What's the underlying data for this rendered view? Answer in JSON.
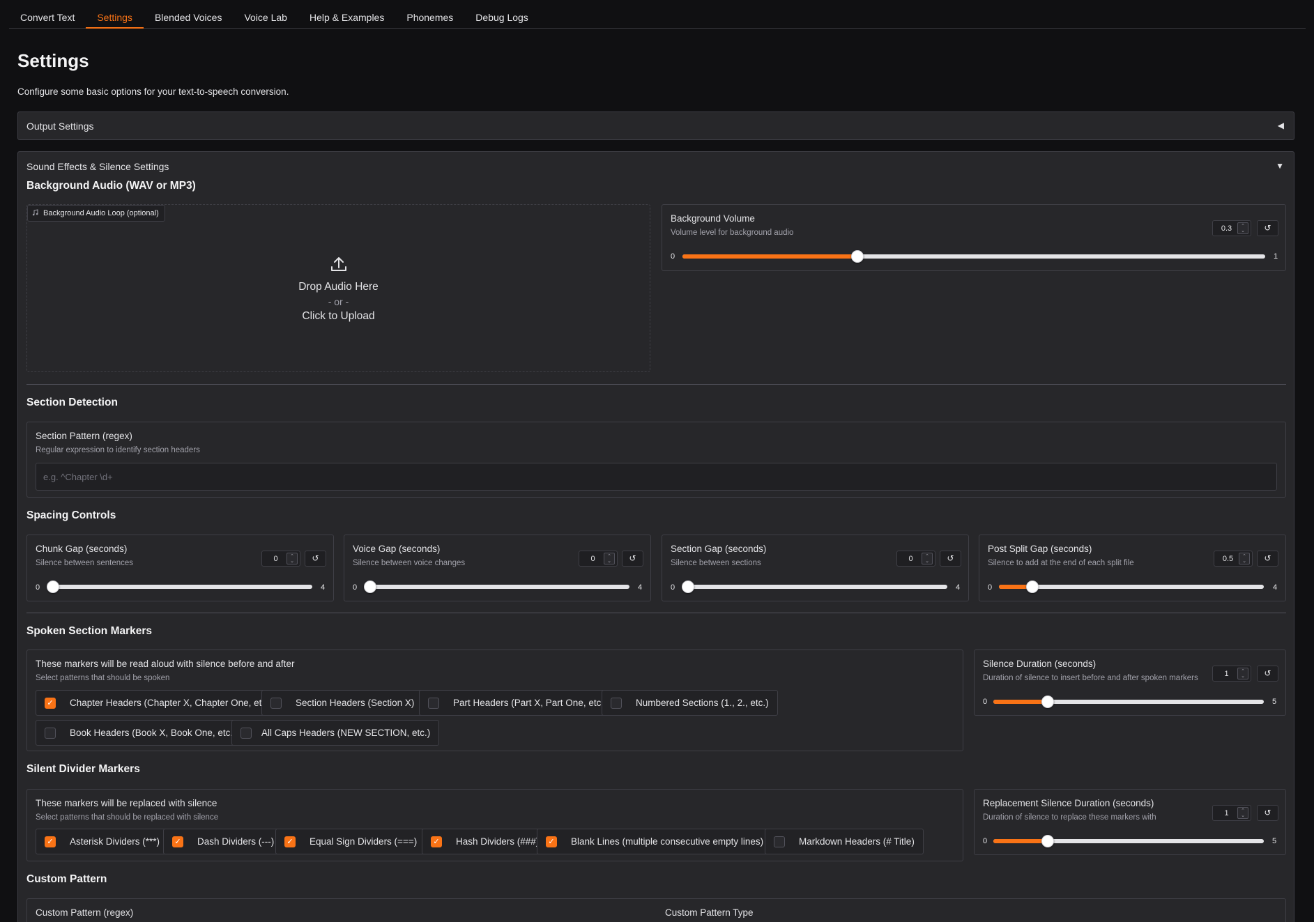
{
  "tabs": [
    "Convert Text",
    "Settings",
    "Blended Voices",
    "Voice Lab",
    "Help & Examples",
    "Phonemes",
    "Debug Logs"
  ],
  "active_tab": "Settings",
  "page": {
    "title": "Settings",
    "description": "Configure some basic options for your text-to-speech conversion."
  },
  "output_settings": {
    "label": "Output Settings",
    "arrow": "◀"
  },
  "sound_effects": {
    "label": "Sound Effects & Silence Settings",
    "arrow": "▼",
    "background_audio": {
      "heading": "Background Audio (WAV or MP3)",
      "tag": "Background Audio Loop (optional)",
      "drop": "Drop Audio Here",
      "or": "- or -",
      "click": "Click to Upload"
    },
    "background_volume": {
      "label": "Background Volume",
      "info": "Volume level for background audio",
      "value": "0.3",
      "min": "0",
      "max": "1",
      "fraction": 0.3
    },
    "section_detection": {
      "heading": "Section Detection",
      "label": "Section Pattern (regex)",
      "info": "Regular expression to identify section headers",
      "placeholder": "e.g. ^Chapter \\d+",
      "value": ""
    },
    "spacing": {
      "heading": "Spacing Controls",
      "controls": [
        {
          "label": "Chunk Gap (seconds)",
          "info": "Silence between sentences",
          "value": "0",
          "min": "0",
          "max": "4",
          "fraction": 0
        },
        {
          "label": "Voice Gap (seconds)",
          "info": "Silence between voice changes",
          "value": "0",
          "min": "0",
          "max": "4",
          "fraction": 0
        },
        {
          "label": "Section Gap (seconds)",
          "info": "Silence between sections",
          "value": "0",
          "min": "0",
          "max": "4",
          "fraction": 0
        },
        {
          "label": "Post Split Gap (seconds)",
          "info": "Silence to add at the end of each split file",
          "value": "0.5",
          "min": "0",
          "max": "4",
          "fraction": 0.125
        }
      ]
    },
    "spoken_markers": {
      "heading": "Spoken Section Markers",
      "label": "These markers will be read aloud with silence before and after",
      "info": "Select patterns that should be spoken",
      "options": [
        {
          "label": "Chapter Headers (Chapter X, Chapter One, etc.)",
          "checked": true
        },
        {
          "label": "Section Headers (Section X)",
          "checked": false
        },
        {
          "label": "Part Headers (Part X, Part One, etc.)",
          "checked": false
        },
        {
          "label": "Numbered Sections (1., 2., etc.)",
          "checked": false
        },
        {
          "label": "Book Headers (Book X, Book One, etc.)",
          "checked": false
        },
        {
          "label": "All Caps Headers (NEW SECTION, etc.)",
          "checked": false
        }
      ],
      "duration": {
        "label": "Silence Duration (seconds)",
        "info": "Duration of silence to insert before and after spoken markers",
        "value": "1",
        "min": "0",
        "max": "5",
        "fraction": 0.2
      }
    },
    "silent_markers": {
      "heading": "Silent Divider Markers",
      "label": "These markers will be replaced with silence",
      "info": "Select patterns that should be replaced with silence",
      "options": [
        {
          "label": "Asterisk Dividers (***)",
          "checked": true
        },
        {
          "label": "Dash Dividers (---)",
          "checked": true
        },
        {
          "label": "Equal Sign Dividers (===)",
          "checked": true
        },
        {
          "label": "Hash Dividers (###)",
          "checked": true
        },
        {
          "label": "Blank Lines (multiple consecutive empty lines)",
          "checked": true
        },
        {
          "label": "Markdown Headers (# Title)",
          "checked": false
        }
      ],
      "duration": {
        "label": "Replacement Silence Duration (seconds)",
        "info": "Duration of silence to replace these markers with",
        "value": "1",
        "min": "0",
        "max": "5",
        "fraction": 0.2
      }
    },
    "custom_pattern": {
      "heading": "Custom Pattern",
      "pattern_label": "Custom Pattern (regex)",
      "type_label": "Custom Pattern Type"
    }
  },
  "icons": {
    "upload": "upload-icon",
    "music": "music-note-icon",
    "reset": "reset-icon",
    "check": "checkmark-icon"
  },
  "colors": {
    "accent": "#f97316",
    "background": "#101012",
    "panel": "#27272a"
  }
}
